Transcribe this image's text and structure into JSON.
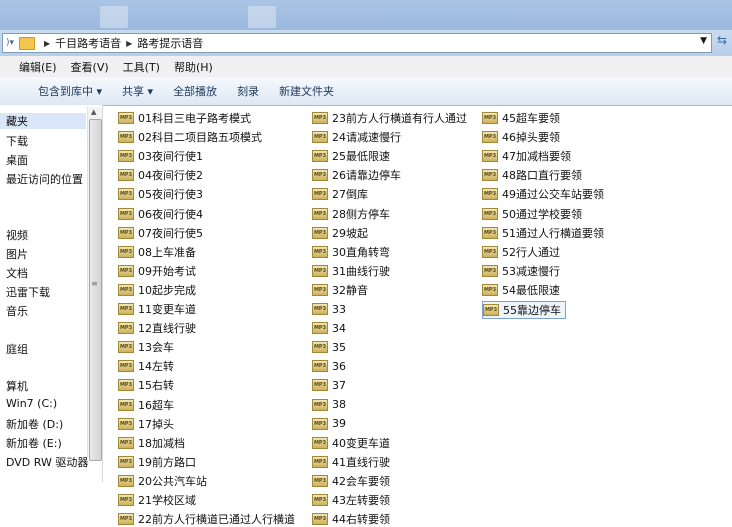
{
  "address": {
    "crumbs": [
      "千目路考语音",
      "路考提示语音"
    ]
  },
  "menu": [
    "编辑(E)",
    "查看(V)",
    "工具(T)",
    "帮助(H)"
  ],
  "toolbar": [
    "包含到库中 ▾",
    "共享 ▾",
    "全部播放",
    "刻录",
    "新建文件夹"
  ],
  "nav": [
    "藏夹",
    "下载",
    "桌面",
    "最近访问的位置",
    "视频",
    "图片",
    "文档",
    "迅雷下载",
    "音乐",
    "庭组",
    "算机",
    "Win7 (C:)",
    "新加卷 (D:)",
    "新加卷 (E:)",
    "DVD RW 驱动器"
  ],
  "icons": {
    "file": "mp3-icon",
    "folder": "folder-icon"
  },
  "files": {
    "col1": [
      "01科目三电子路考模式",
      "02科目二项目路五项模式",
      "03夜间行使1",
      "04夜间行使2",
      "05夜间行使3",
      "06夜间行使4",
      "07夜间行使5",
      "08上车准备",
      "09开始考试",
      "10起步完成",
      "11变更车道",
      "12直线行驶",
      "13会车",
      "14左转",
      "15右转",
      "16超车",
      "17掉头",
      "18加减档",
      "19前方路口",
      "20公共汽车站",
      "21学校区域",
      "22前方人行横道已通过人行横道"
    ],
    "col2": [
      "23前方人行横道有行人通过",
      "24请减速慢行",
      "25最低限速",
      "26请靠边停车",
      "27倒库",
      "28侧方停车",
      "29坡起",
      "30直角转弯",
      "31曲线行驶",
      "32静音",
      "33",
      "34",
      "35",
      "36",
      "37",
      "38",
      "39",
      "40变更车道",
      "41直线行驶",
      "42会车要领",
      "43左转要领",
      "44右转要领"
    ],
    "col3": [
      "45超车要领",
      "46掉头要领",
      "47加减档要领",
      "48路口直行要领",
      "49通过公交车站要领",
      "50通过学校要领",
      "51通过人行横道要领",
      "52行人通过",
      "53减速慢行",
      "54最低限速",
      "55靠边停车"
    ]
  }
}
